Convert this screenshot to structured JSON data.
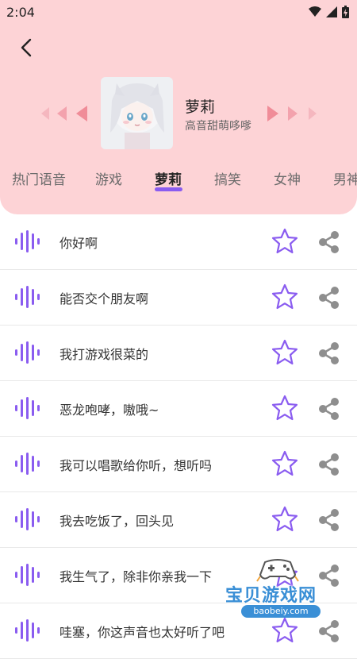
{
  "status_bar": {
    "time": "2:04"
  },
  "character": {
    "name": "萝莉",
    "description": "高音甜萌哆嗲"
  },
  "tabs": [
    {
      "label": "热门语音",
      "active": false
    },
    {
      "label": "游戏",
      "active": false
    },
    {
      "label": "萝莉",
      "active": true
    },
    {
      "label": "搞笑",
      "active": false
    },
    {
      "label": "女神",
      "active": false
    },
    {
      "label": "男神",
      "active": false
    }
  ],
  "voice_list": [
    {
      "text": "你好啊"
    },
    {
      "text": "能否交个朋友啊"
    },
    {
      "text": "我打游戏很菜的"
    },
    {
      "text": "恶龙咆哮，嗷哦~"
    },
    {
      "text": "我可以唱歌给你听，想听吗"
    },
    {
      "text": "我去吃饭了，回头见"
    },
    {
      "text": "我生气了，除非你亲我一下"
    },
    {
      "text": "哇塞，你这声音也太好听了吧"
    }
  ],
  "watermark": {
    "title": "宝贝游戏网",
    "url": "baobeiy.com"
  },
  "colors": {
    "header_bg": "#fdd3d6",
    "accent_purple": "#8a5cf0",
    "arrow_pink": "#f08c98",
    "share_gray": "#8e8e8e"
  },
  "icons": {
    "back": "chevron-left-icon",
    "favorite": "star-outline-icon",
    "share": "share-icon",
    "voice": "sound-wave-icon"
  }
}
